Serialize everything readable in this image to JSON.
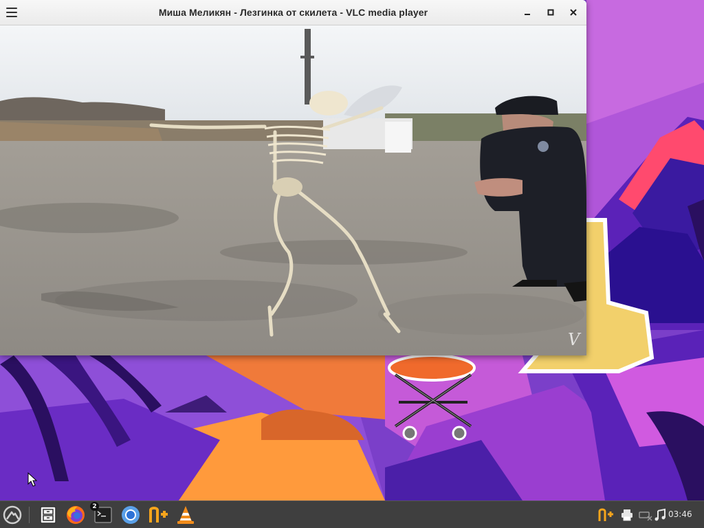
{
  "window": {
    "title": "Миша Меликян - Лезгинка от скилета - VLC media player",
    "menu_icon": "hamburger-menu-icon",
    "controls": [
      "minimize-icon",
      "maximize-icon",
      "close-icon"
    ]
  },
  "video": {
    "content": "video-frame",
    "watermark_icon": "vlc-watermark-icon"
  },
  "taskbar": {
    "launcher_icon": "mountain-logo-icon",
    "apps": [
      {
        "name": "file-manager",
        "icon": "file-cabinet-icon"
      },
      {
        "name": "firefox",
        "icon": "firefox-icon"
      },
      {
        "name": "terminal",
        "icon": "terminal-icon",
        "badge": "2"
      },
      {
        "name": "chromium",
        "icon": "chromium-icon"
      },
      {
        "name": "app-n-plus",
        "icon": "n-plus-icon"
      },
      {
        "name": "vlc",
        "icon": "vlc-cone-icon"
      }
    ],
    "tray": [
      "n-plus-tray-icon",
      "printer-icon",
      "network-disconnected-icon",
      "volume-music-icon"
    ],
    "clock": "03:46"
  },
  "colors": {
    "taskbar_bg": "#3f3f3f",
    "titlebar_bg": "#efefef",
    "wallpaper_purple": "#7b3fc9",
    "wallpaper_orange": "#f07a3a",
    "vlc_orange": "#f28c1b"
  }
}
